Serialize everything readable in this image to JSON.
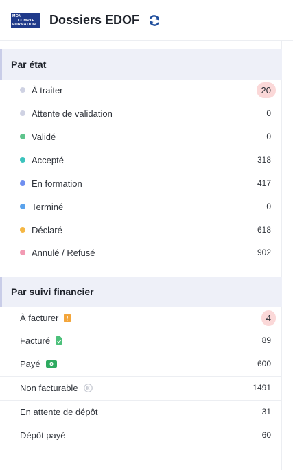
{
  "header": {
    "logo_lines": [
      "MON",
      "COMPTE",
      "FORMATION"
    ],
    "title": "Dossiers EDOF",
    "refresh_icon": "refresh-icon"
  },
  "by_state": {
    "title": "Par état",
    "items": [
      {
        "label": "À traiter",
        "count": "20",
        "color": "#cfd2e3",
        "highlight": true
      },
      {
        "label": "Attente de validation",
        "count": "0",
        "color": "#cfd2e3"
      },
      {
        "label": "Validé",
        "count": "0",
        "color": "#5ec48c"
      },
      {
        "label": "Accepté",
        "count": "318",
        "color": "#3cc3bd"
      },
      {
        "label": "En formation",
        "count": "417",
        "color": "#6f8ff0"
      },
      {
        "label": "Terminé",
        "count": "0",
        "color": "#5aa2ec"
      },
      {
        "label": "Déclaré",
        "count": "618",
        "color": "#f5b744"
      },
      {
        "label": "Annulé / Refusé",
        "count": "902",
        "color": "#f29ab3"
      }
    ]
  },
  "by_finance": {
    "title": "Par suivi financier",
    "items": [
      {
        "label": "À facturer",
        "count": "4",
        "icon": "invoice-pending-icon",
        "highlight": true
      },
      {
        "label": "Facturé",
        "count": "89",
        "icon": "invoice-done-icon"
      },
      {
        "label": "Payé",
        "count": "600",
        "icon": "banknote-icon"
      },
      {
        "label": "Non facturable",
        "count": "1491",
        "icon": "no-euro-icon"
      },
      {
        "label": "En attente de dépôt",
        "count": "31"
      },
      {
        "label": "Dépôt payé",
        "count": "60"
      }
    ]
  }
}
